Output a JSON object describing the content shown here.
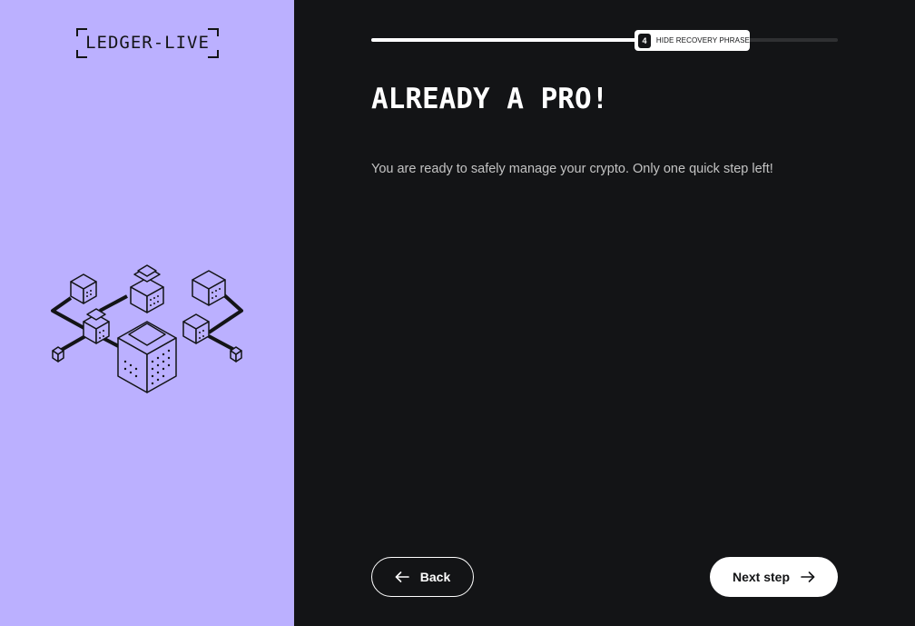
{
  "app": {
    "logo_text": "LEDGER-LIVE"
  },
  "progress": {
    "step_number": "4",
    "step_label": "HIDE RECOVERY PHRASE",
    "fraction": 0.58
  },
  "content": {
    "title": "ALREADY A PRO!",
    "subtitle": "You are ready to safely manage your crypto. Only one quick step left!"
  },
  "footer": {
    "back_label": "Back",
    "next_label": "Next step"
  },
  "colors": {
    "left_panel": "#bbb0ff",
    "background": "#131416",
    "text": "#ffffff",
    "muted_text": "#c3c3c3"
  },
  "icons": {
    "logo_frame": "corner-bracket-icon",
    "back": "arrow-left-icon",
    "next": "arrow-right-icon",
    "illustration": "blockchain-cubes-illustration"
  }
}
